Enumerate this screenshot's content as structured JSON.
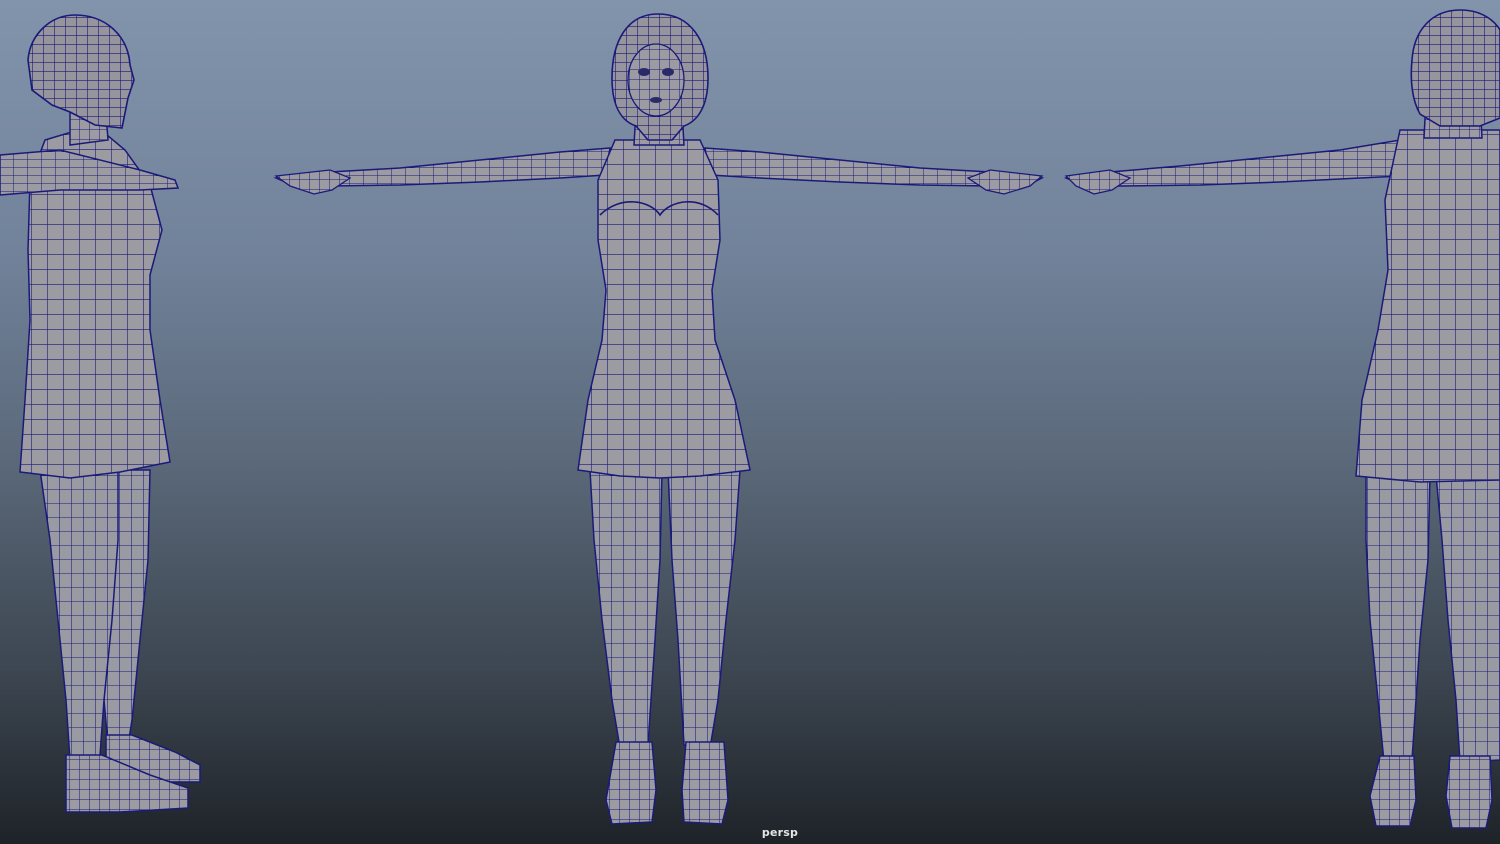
{
  "viewport": {
    "camera_label": "persp"
  },
  "colors": {
    "bg_top": "#8294ab",
    "bg_bottom": "#1e2328",
    "mesh_fill": "#9c9ba2",
    "wire": "#1a1a7a"
  },
  "models": [
    {
      "view": "side"
    },
    {
      "view": "front"
    },
    {
      "view": "back"
    }
  ]
}
